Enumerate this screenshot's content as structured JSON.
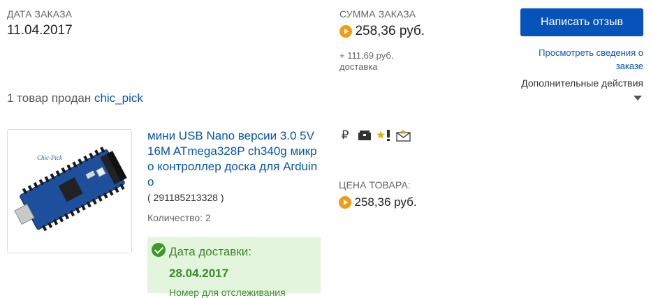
{
  "order": {
    "date_label": "ДАТА ЗАКАЗА",
    "date_value": "11.04.2017",
    "total_label": "СУММА ЗАКАЗА",
    "total_value": "258,36 руб.",
    "shipping_amount": "+ 111,69 руб.",
    "shipping_label": "доставка"
  },
  "actions": {
    "feedback_button": "Написать отзыв",
    "details_link": "Просмотреть сведения о заказе",
    "more_actions": "Дополнительные действия"
  },
  "seller": {
    "prefix": "1 товар продан",
    "name": "chic_pick"
  },
  "item": {
    "title": "мини USB Nano версии 3.0 5V 16M ATmega328P ch340g микро контроллер доска для Arduino",
    "item_number": "( 291185213328 )",
    "quantity": "Количество: 2",
    "price_label": "ЦЕНА ТОВАРА:",
    "price_value": "258,36 руб.",
    "image_watermark": "Chic-Pick",
    "status_icons": [
      "ruble-icon",
      "package-icon",
      "star-feedback-icon",
      "message-icon"
    ],
    "status_glyphs": {
      "ruble": "₽"
    }
  },
  "delivery": {
    "label": "Дата доставки:",
    "date": "28.04.2017",
    "tracking_partial": "Номер для отслеживания"
  },
  "colors": {
    "accent_blue": "#0654ba",
    "coin_orange": "#f39c12",
    "delivery_green_bg": "#e3f5dc",
    "delivery_green_text": "#3a8a2a"
  }
}
